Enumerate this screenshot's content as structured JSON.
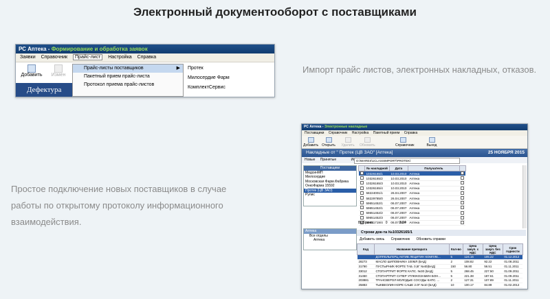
{
  "headline": "Электронный документооборот с поставщиками",
  "caption_right": "Импорт прайс листов, электронных накладных, отказов.",
  "caption_left": "Простое подключение новых поставщиков в случае работы по открытому протоколу информационного взаимодействия.",
  "shot1": {
    "title_app": "РС Аптека - ",
    "title_window": "Формирование и обработка заявок",
    "menu": [
      "Заявки",
      "Справочник",
      "Прайс-лист",
      "Настройка",
      "Справка"
    ],
    "tool_add": "Добавить",
    "tool_change": "Измен",
    "defect": "Дефектура",
    "submenu": [
      "Прайс-листы поставщиков",
      "Пакетный прием прайс-листа",
      "Протокол приема прайс-листов"
    ],
    "submenu_arrow": "▶",
    "suppliers": [
      "Протек",
      "Милосердие Фарм",
      "КомплектСервис"
    ]
  },
  "shot2": {
    "title_app": "РС Аптека - ",
    "title_window": "Электронные накладные",
    "menu": [
      "Поставщики",
      "Справочник",
      "Настройка",
      "Пакетный прием",
      "Справка"
    ],
    "tools": [
      "Добавить",
      "Открыть",
      "Удалить",
      "Обновить",
      "Справочник",
      "Выход"
    ],
    "header": "Накладные от \" Протек (ЦВ ЗАО\" [Аптека]",
    "header_date": "25 НОЯБРЯ 2015",
    "sub": [
      "Новые",
      "Принятые",
      "Источник"
    ],
    "path": "O:\\WARES\\1CLASSIMPORT\\PROTEK\\",
    "suppliers_title": "Поставщики",
    "suppliers": [
      "МедсинМП",
      "Милосердие",
      "Московская Фарм.Фабрика",
      "ОнкоФарма 15592",
      "Протек (ЦВ ЗАО)",
      "Рулис"
    ],
    "tree_title": "Аптека",
    "tree": [
      "Все отделы",
      "Аптека"
    ],
    "doc_headers": [
      "",
      "№ накладной",
      "Дата",
      "Получатель",
      ""
    ],
    "docs": [
      [
        "10326165/1",
        "10.03.2010",
        "Аптека"
      ],
      [
        "10326165/2",
        "10.03.2010",
        "Аптека"
      ],
      [
        "10326165/3",
        "10.03.2010",
        "Аптека"
      ],
      [
        "10326165/4",
        "10.03.2010",
        "Аптека"
      ],
      [
        "58224001/1",
        "26.04.2007",
        "Аптека"
      ],
      [
        "58229785/0",
        "26.04.2007",
        "Аптека"
      ],
      [
        "59651452/1",
        "06.07.2007",
        "Аптека"
      ],
      [
        "59651452/1",
        "06.07.2007",
        "Аптека"
      ],
      [
        "59651452/2",
        "06.07.2007",
        "Аптека"
      ],
      [
        "59651452/3",
        "06.07.2007",
        "Аптека"
      ],
      [
        "59651719/4",
        "06.07.2007",
        "Аптека"
      ]
    ],
    "summary_label": "Выбрано:",
    "summary_a": "0",
    "summary_b": "8.24",
    "lines_title": "Строки док-та №10326165/1",
    "lines_tools": [
      "Добавить связь",
      "Справочник",
      "Обновить справки"
    ],
    "line_headers": [
      "Код",
      "Название препарата",
      "Кол-во",
      "Цена закуп. с НДС",
      "Цена закуп. без НДС",
      "Срок годности"
    ],
    "lines": [
      [
        "",
        "ДОППЕЛЬГЕРЦ АКТИВ ЛЕЦИТИН КОМПЛЕ...",
        "5",
        "124.16",
        "105.22",
        "01.12.2012"
      ],
      [
        "28273",
        "МАСЛО ШИПОВНИКА 100МЛ (БАД)",
        "2",
        "108.82",
        "92.22",
        "01.08.2011"
      ],
      [
        "31790",
        "ПУСТЫРНИК ФОРТЕ ТАБ. 0,5Г №40(БАД)",
        "150",
        "56.80",
        "56.51",
        "01.11.2011"
      ],
      [
        "33012",
        "СТОПАРТРИТ ФОРТЕ КАПС. №30 (БАД)",
        "5",
        "268.45",
        "227.50",
        "01.09.2011"
      ],
      [
        "31450",
        "СТОПАРТРИТ СУПЕР УГЛЮКОЗАМИН БОН...",
        "5",
        "221.38",
        "187.61",
        "01.09.2011"
      ],
      [
        "203881",
        "ТРАНСВЕРОЛ МОЛОДЫЕ СОСУДЫ КАПС. ...",
        "2",
        "127.31",
        "107.89",
        "01.11.2011"
      ],
      [
        "25883",
        "ТЫКВЕОЛИН КОРЕ САШЕ 2.0Г №10 (БАД)",
        "10",
        "100.17",
        "84.89",
        "01.02.2012"
      ]
    ]
  }
}
